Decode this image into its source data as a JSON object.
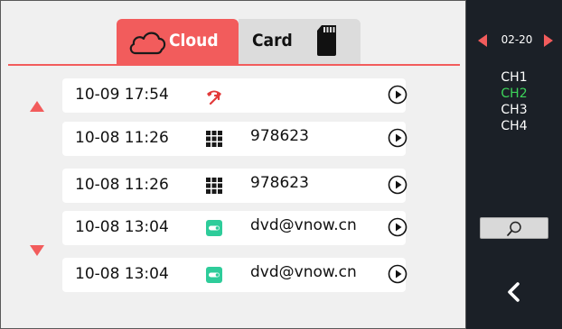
{
  "tabs": [
    {
      "label": "Cloud",
      "icon": "cloud-icon",
      "active": true
    },
    {
      "label": "Card",
      "icon": "sd-card-icon",
      "active": false
    }
  ],
  "records": [
    {
      "datetime": "10-09  17:54",
      "type_icon": "missed-call-icon",
      "info": ""
    },
    {
      "datetime": "10-08  11:26",
      "type_icon": "keypad-icon",
      "info": "978623"
    },
    {
      "datetime": "10-08  11:26",
      "type_icon": "keypad-icon",
      "info": "978623"
    },
    {
      "datetime": "10-08  13:04",
      "type_icon": "card-swipe-icon",
      "info": "dvd@vnow.cn"
    },
    {
      "datetime": "10-08  13:04",
      "type_icon": "card-swipe-icon",
      "info": "dvd@vnow.cn"
    }
  ],
  "sidebar": {
    "date": "02-20",
    "channels": [
      "CH1",
      "CH2",
      "CH3",
      "CH4"
    ],
    "active_channel": "CH2"
  },
  "colors": {
    "accent_red": "#f25c5c",
    "active_channel_green": "#3dd45a",
    "card_icon_teal": "#2ecc9a",
    "sidebar_bg": "#1b2027"
  }
}
